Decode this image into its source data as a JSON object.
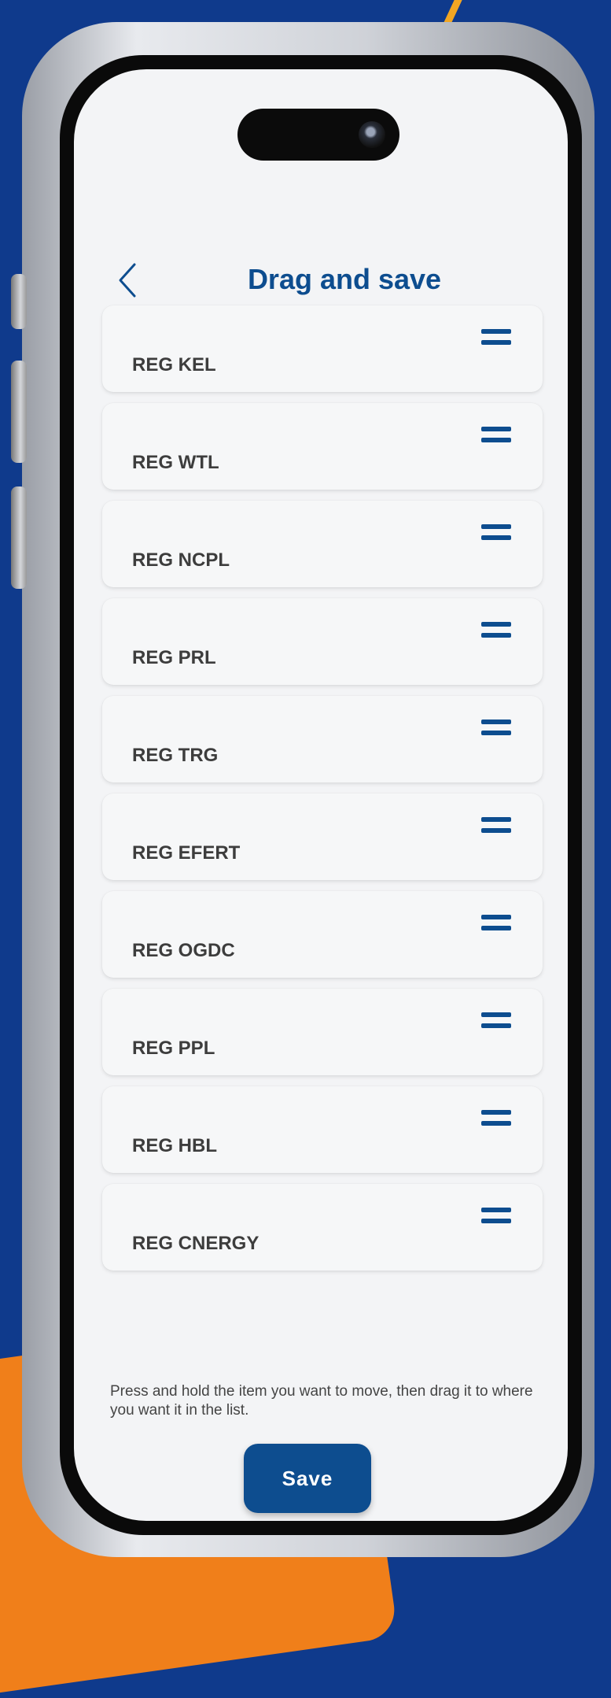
{
  "colors": {
    "accent": "#0d4d8f",
    "background": "#0f3a8c",
    "orange": "#f07f1a"
  },
  "header": {
    "title": "Drag and save",
    "back_icon": "chevron-left-icon"
  },
  "list": {
    "items": [
      {
        "label": "REG KEL"
      },
      {
        "label": "REG WTL"
      },
      {
        "label": "REG NCPL"
      },
      {
        "label": "REG PRL"
      },
      {
        "label": "REG TRG"
      },
      {
        "label": "REG EFERT"
      },
      {
        "label": "REG OGDC"
      },
      {
        "label": "REG PPL"
      },
      {
        "label": "REG HBL"
      },
      {
        "label": "REG CNERGY"
      }
    ],
    "handle_icon": "drag-handle-icon"
  },
  "helper_text": "Press and hold the item you want to move, then drag it to where you want it in the list.",
  "save_label": "Save"
}
